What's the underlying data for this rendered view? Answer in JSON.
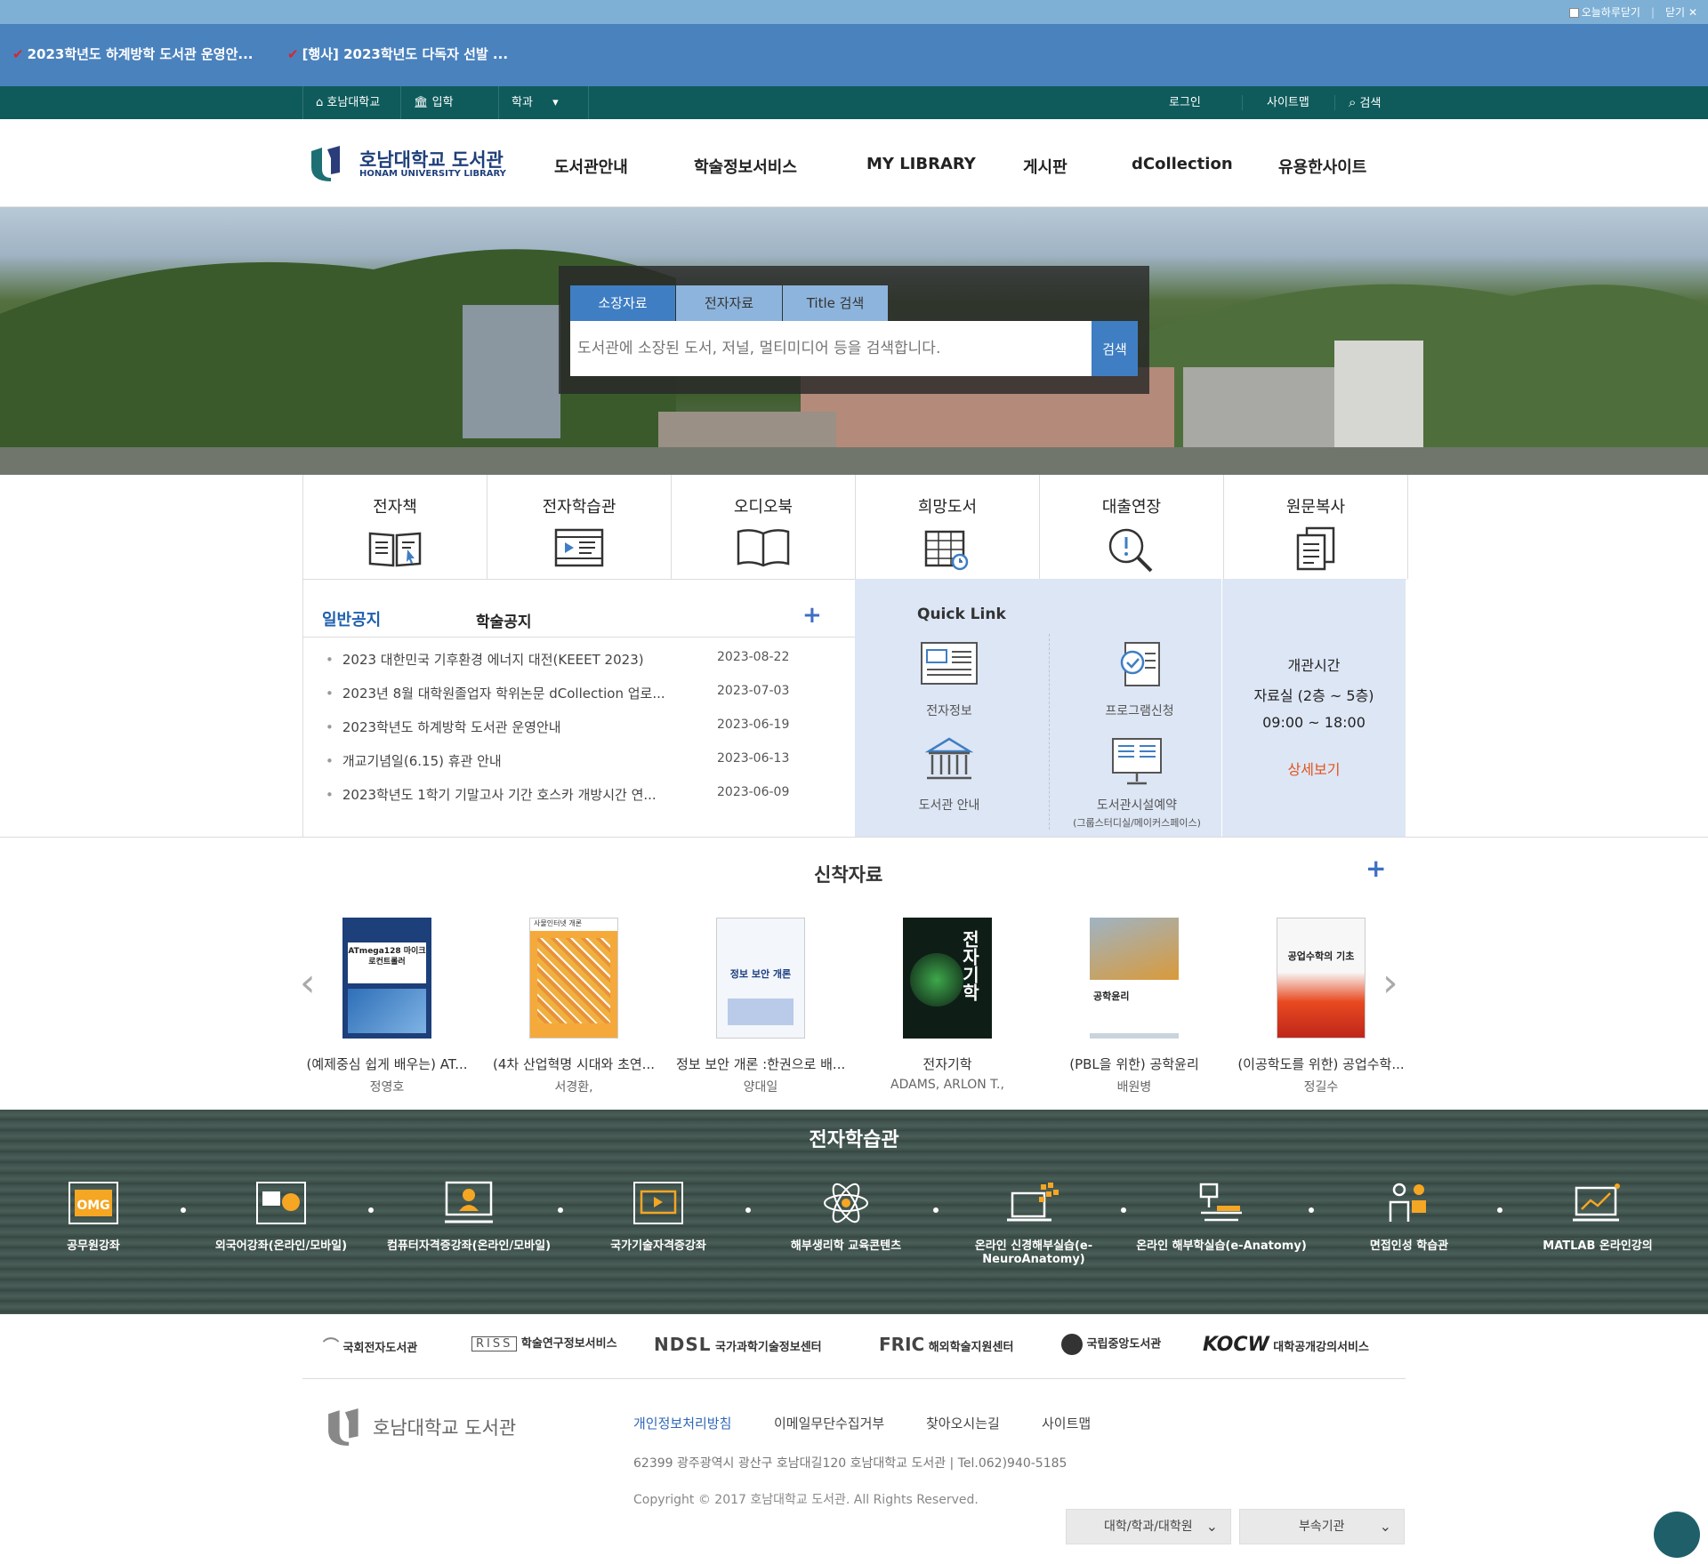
{
  "popup": {
    "today_close": "오늘하루닫기",
    "close": "닫기",
    "items": [
      "2023학년도 하계방학 도서관 운영안...",
      "[행사] 2023학년도 다독자 선발 ..."
    ]
  },
  "util": {
    "home": "호남대학교",
    "admission": "입학",
    "dept": "학과",
    "login": "로그인",
    "sitemap": "사이트맵",
    "search": "검색"
  },
  "header": {
    "logo_ko": "호남대학교 도서관",
    "logo_en": "HONAM UNIVERSITY LIBRARY",
    "nav": [
      "도서관안내",
      "학술정보서비스",
      "MY LIBRARY",
      "게시판",
      "dCollection",
      "유용한사이트"
    ]
  },
  "search": {
    "tabs": [
      "소장자료",
      "전자자료",
      "Title 검색"
    ],
    "placeholder": "도서관에 소장된 도서, 저널, 멀티미디어 등을 검색합니다.",
    "button": "검색"
  },
  "services": [
    "전자책",
    "전자학습관",
    "오디오북",
    "희망도서",
    "대출연장",
    "원문복사"
  ],
  "notice": {
    "tabs": [
      "일반공지",
      "학술공지"
    ],
    "more": "+",
    "items": [
      {
        "title": "2023 대한민국 기후환경 에너지 대전(KEEET 2023)",
        "date": "2023-08-22"
      },
      {
        "title": "2023년 8월 대학원졸업자 학위논문 dCollection 업로...",
        "date": "2023-07-03"
      },
      {
        "title": "2023학년도 하계방학 도서관 운영안내",
        "date": "2023-06-19"
      },
      {
        "title": "개교기념일(6.15) 휴관 안내",
        "date": "2023-06-13"
      },
      {
        "title": "2023학년도 1학기 기말고사 기간 호스카 개방시간 연...",
        "date": "2023-06-09"
      }
    ]
  },
  "quick": {
    "title": "Quick Link",
    "items": [
      "전자정보",
      "프로그램신청",
      "도서관 안내",
      "도서관시설예약"
    ],
    "sub": "(그룹스터디실/메이커스페이스)"
  },
  "hours": {
    "title": "개관시간",
    "room": "자료실 (2층 ~ 5층)",
    "time": "09:00 ~ 18:00",
    "more": "상세보기"
  },
  "newbooks": {
    "title": "신착자료",
    "more": "+",
    "items": [
      {
        "title": "(예제중심 쉽게 배우는) AT...",
        "author": "정영호"
      },
      {
        "title": "(4차 산업혁명 시대와 초연...",
        "author": "서경환,"
      },
      {
        "title": "정보 보안 개론 :한권으로 배...",
        "author": "양대일"
      },
      {
        "title": "전자기학",
        "author": "ADAMS, ARLON T.,"
      },
      {
        "title": "(PBL을 위한) 공학윤리",
        "author": "배원병"
      },
      {
        "title": "(이공학도를 위한) 공업수학...",
        "author": "정길수"
      }
    ],
    "covers": [
      "ATmega128 마이크로컨트롤러",
      "사물인터넷 개론",
      "정보 보안 개론",
      "전자기학",
      "공학윤리",
      "공업수학의 기초"
    ]
  },
  "elearn": {
    "title": "전자학습관",
    "items": [
      "공무원강좌",
      "외국어강좌(온라인/모바일)",
      "컴퓨터자격증강좌(온라인/모바일)",
      "국가기술자격증강좌",
      "해부생리학 교육콘텐츠",
      "온라인 신경해부실습(e-NeuroAnatomy)",
      "온라인 해부학실습(e-Anatomy)",
      "면접인성 학습관",
      "MATLAB 온라인강의"
    ]
  },
  "links": [
    "국회전자도서관",
    "학술연구정보서비스",
    "국가과학기술정보센터",
    "해외학술지원센터",
    "국립중앙도서관",
    "대학공개강의서비스"
  ],
  "link_logos": [
    "RISS",
    "NDSL",
    "FRIC",
    "KOCW"
  ],
  "footer": {
    "logo": "호남대학교 도서관",
    "menu": [
      "개인정보처리방침",
      "이메일무단수집거부",
      "찾아오시는길",
      "사이트맵"
    ],
    "address": "62399 광주광역시 광산구 호남대길120 호남대학교 도서관 | Tel.062)940-5185",
    "copyright": "Copyright © 2017 호남대학교 도서관. All Rights Reserved.",
    "select1": "대학/학과/대학원",
    "select2": "부속기관"
  }
}
